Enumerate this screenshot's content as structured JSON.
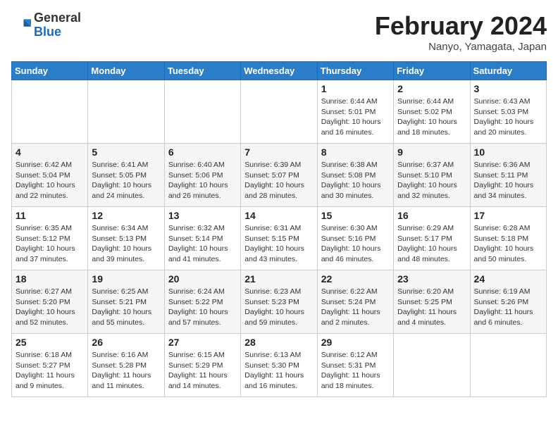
{
  "logo": {
    "general": "General",
    "blue": "Blue"
  },
  "title": "February 2024",
  "subtitle": "Nanyo, Yamagata, Japan",
  "days_of_week": [
    "Sunday",
    "Monday",
    "Tuesday",
    "Wednesday",
    "Thursday",
    "Friday",
    "Saturday"
  ],
  "weeks": [
    [
      {
        "day": "",
        "info": ""
      },
      {
        "day": "",
        "info": ""
      },
      {
        "day": "",
        "info": ""
      },
      {
        "day": "",
        "info": ""
      },
      {
        "day": "1",
        "info": "Sunrise: 6:44 AM\nSunset: 5:01 PM\nDaylight: 10 hours\nand 16 minutes."
      },
      {
        "day": "2",
        "info": "Sunrise: 6:44 AM\nSunset: 5:02 PM\nDaylight: 10 hours\nand 18 minutes."
      },
      {
        "day": "3",
        "info": "Sunrise: 6:43 AM\nSunset: 5:03 PM\nDaylight: 10 hours\nand 20 minutes."
      }
    ],
    [
      {
        "day": "4",
        "info": "Sunrise: 6:42 AM\nSunset: 5:04 PM\nDaylight: 10 hours\nand 22 minutes."
      },
      {
        "day": "5",
        "info": "Sunrise: 6:41 AM\nSunset: 5:05 PM\nDaylight: 10 hours\nand 24 minutes."
      },
      {
        "day": "6",
        "info": "Sunrise: 6:40 AM\nSunset: 5:06 PM\nDaylight: 10 hours\nand 26 minutes."
      },
      {
        "day": "7",
        "info": "Sunrise: 6:39 AM\nSunset: 5:07 PM\nDaylight: 10 hours\nand 28 minutes."
      },
      {
        "day": "8",
        "info": "Sunrise: 6:38 AM\nSunset: 5:08 PM\nDaylight: 10 hours\nand 30 minutes."
      },
      {
        "day": "9",
        "info": "Sunrise: 6:37 AM\nSunset: 5:10 PM\nDaylight: 10 hours\nand 32 minutes."
      },
      {
        "day": "10",
        "info": "Sunrise: 6:36 AM\nSunset: 5:11 PM\nDaylight: 10 hours\nand 34 minutes."
      }
    ],
    [
      {
        "day": "11",
        "info": "Sunrise: 6:35 AM\nSunset: 5:12 PM\nDaylight: 10 hours\nand 37 minutes."
      },
      {
        "day": "12",
        "info": "Sunrise: 6:34 AM\nSunset: 5:13 PM\nDaylight: 10 hours\nand 39 minutes."
      },
      {
        "day": "13",
        "info": "Sunrise: 6:32 AM\nSunset: 5:14 PM\nDaylight: 10 hours\nand 41 minutes."
      },
      {
        "day": "14",
        "info": "Sunrise: 6:31 AM\nSunset: 5:15 PM\nDaylight: 10 hours\nand 43 minutes."
      },
      {
        "day": "15",
        "info": "Sunrise: 6:30 AM\nSunset: 5:16 PM\nDaylight: 10 hours\nand 46 minutes."
      },
      {
        "day": "16",
        "info": "Sunrise: 6:29 AM\nSunset: 5:17 PM\nDaylight: 10 hours\nand 48 minutes."
      },
      {
        "day": "17",
        "info": "Sunrise: 6:28 AM\nSunset: 5:18 PM\nDaylight: 10 hours\nand 50 minutes."
      }
    ],
    [
      {
        "day": "18",
        "info": "Sunrise: 6:27 AM\nSunset: 5:20 PM\nDaylight: 10 hours\nand 52 minutes."
      },
      {
        "day": "19",
        "info": "Sunrise: 6:25 AM\nSunset: 5:21 PM\nDaylight: 10 hours\nand 55 minutes."
      },
      {
        "day": "20",
        "info": "Sunrise: 6:24 AM\nSunset: 5:22 PM\nDaylight: 10 hours\nand 57 minutes."
      },
      {
        "day": "21",
        "info": "Sunrise: 6:23 AM\nSunset: 5:23 PM\nDaylight: 10 hours\nand 59 minutes."
      },
      {
        "day": "22",
        "info": "Sunrise: 6:22 AM\nSunset: 5:24 PM\nDaylight: 11 hours\nand 2 minutes."
      },
      {
        "day": "23",
        "info": "Sunrise: 6:20 AM\nSunset: 5:25 PM\nDaylight: 11 hours\nand 4 minutes."
      },
      {
        "day": "24",
        "info": "Sunrise: 6:19 AM\nSunset: 5:26 PM\nDaylight: 11 hours\nand 6 minutes."
      }
    ],
    [
      {
        "day": "25",
        "info": "Sunrise: 6:18 AM\nSunset: 5:27 PM\nDaylight: 11 hours\nand 9 minutes."
      },
      {
        "day": "26",
        "info": "Sunrise: 6:16 AM\nSunset: 5:28 PM\nDaylight: 11 hours\nand 11 minutes."
      },
      {
        "day": "27",
        "info": "Sunrise: 6:15 AM\nSunset: 5:29 PM\nDaylight: 11 hours\nand 14 minutes."
      },
      {
        "day": "28",
        "info": "Sunrise: 6:13 AM\nSunset: 5:30 PM\nDaylight: 11 hours\nand 16 minutes."
      },
      {
        "day": "29",
        "info": "Sunrise: 6:12 AM\nSunset: 5:31 PM\nDaylight: 11 hours\nand 18 minutes."
      },
      {
        "day": "",
        "info": ""
      },
      {
        "day": "",
        "info": ""
      }
    ]
  ]
}
